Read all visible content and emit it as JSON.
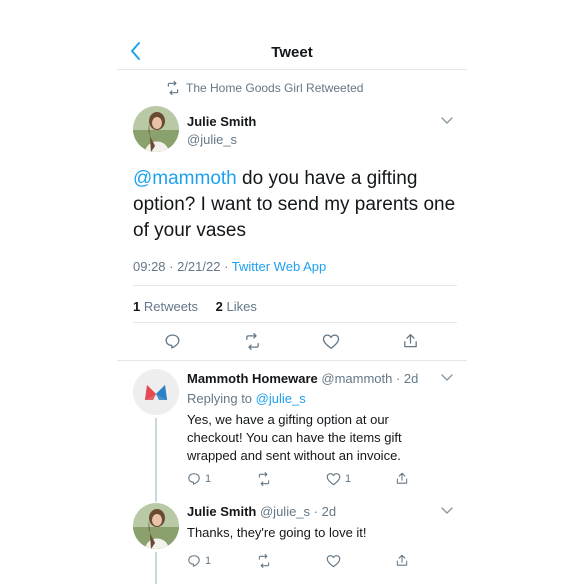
{
  "header": {
    "title": "Tweet"
  },
  "retweet_context": {
    "text": "The Home Goods Girl Retweeted"
  },
  "main_tweet": {
    "author_name": "Julie Smith",
    "author_handle": "@julie_s",
    "mention": "@mammoth",
    "body": " do you have a gifting option? I want to send my parents one of your vases",
    "time": "09:28 · 2/21/22 · ",
    "source": "Twitter Web App",
    "retweets_count": "1",
    "retweets_label": " Retweets",
    "likes_count": "2",
    "likes_label": " Likes"
  },
  "replies": [
    {
      "author_name": "Mammoth Homeware",
      "author_handle": "@mammoth · 2d",
      "replying_prefix": "Replying to ",
      "replying_to": "@julie_s",
      "body": "Yes, we have a gifting option at our checkout! You can have the items gift wrapped and sent without an invoice.",
      "reply_count": "1",
      "like_count": "1"
    },
    {
      "author_name": "Julie Smith",
      "author_handle": "@julie_s · 2d",
      "body": "Thanks, they're going to love it!",
      "reply_count": "1"
    }
  ],
  "colors": {
    "accent": "#1da1f2",
    "mammoth_red": "#f2545b",
    "mammoth_blue": "#2f8fd6"
  }
}
